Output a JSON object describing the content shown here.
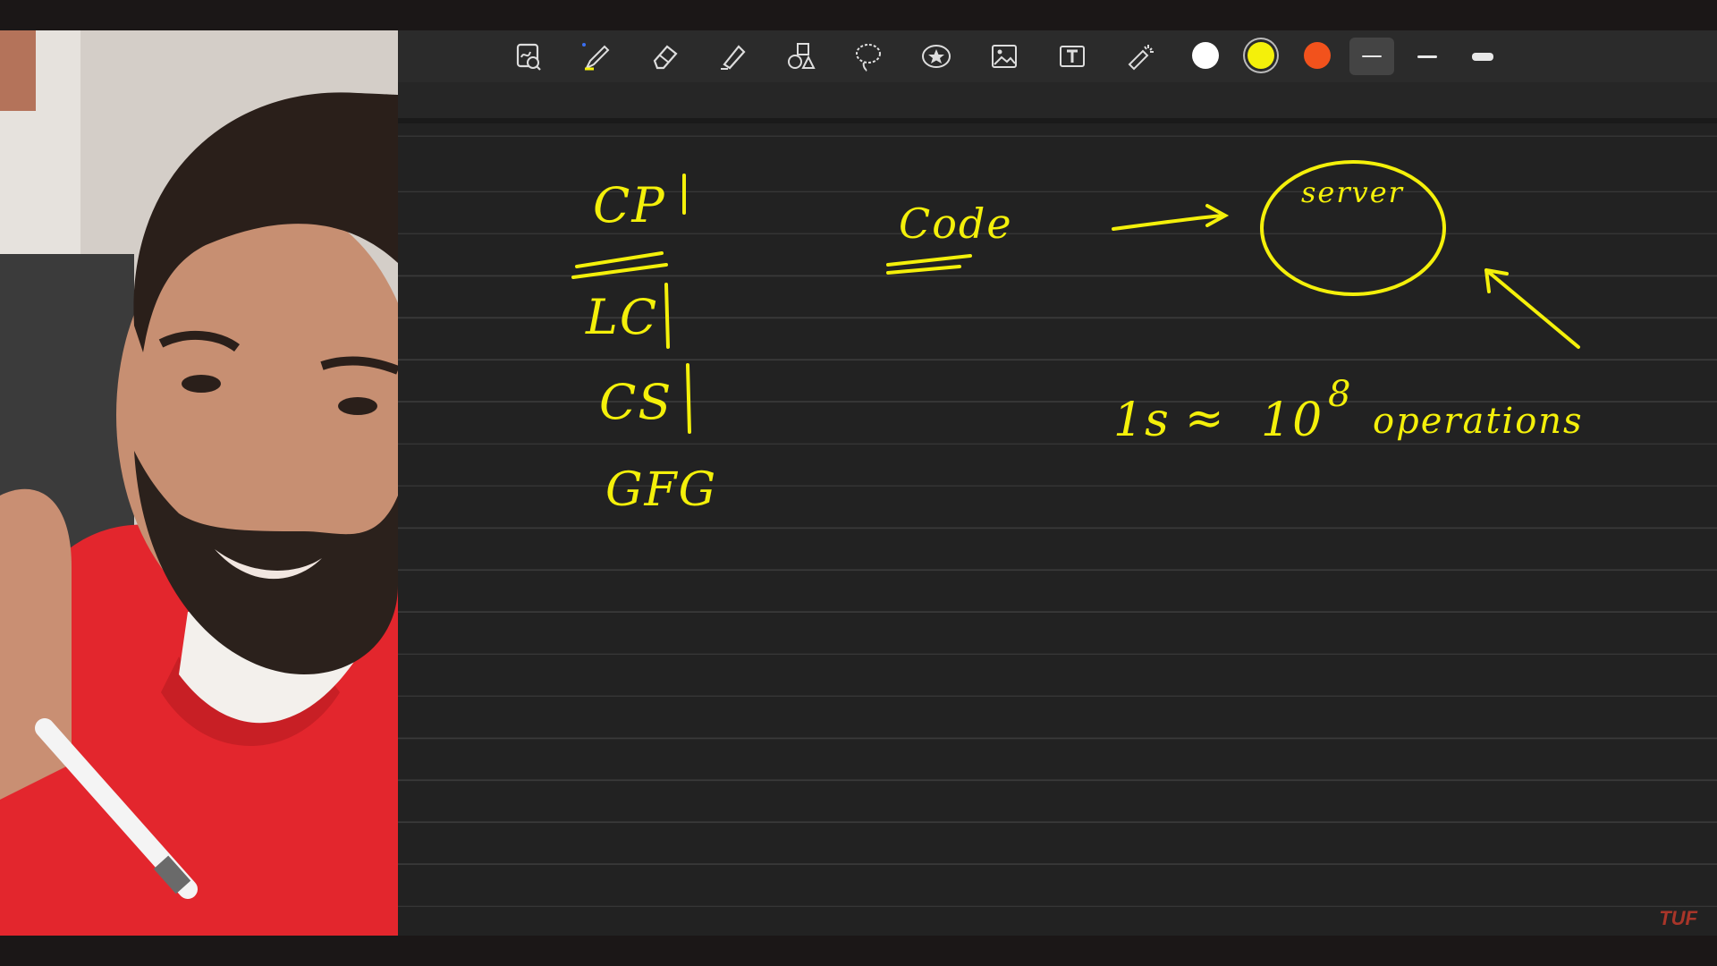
{
  "toolbar": {
    "tools": [
      {
        "name": "add-page-tool",
        "icon": "page-add-icon"
      },
      {
        "name": "pen-tool",
        "icon": "pen-icon"
      },
      {
        "name": "eraser-tool",
        "icon": "eraser-icon"
      },
      {
        "name": "highlighter-tool",
        "icon": "highlighter-icon"
      },
      {
        "name": "shapes-tool",
        "icon": "shapes-icon"
      },
      {
        "name": "lasso-tool",
        "icon": "lasso-icon"
      },
      {
        "name": "sticker-tool",
        "icon": "star-sticker-icon"
      },
      {
        "name": "image-tool",
        "icon": "image-icon"
      },
      {
        "name": "text-tool",
        "icon": "text-box-icon"
      },
      {
        "name": "laser-pointer-tool",
        "icon": "laser-pointer-icon"
      }
    ],
    "colors": [
      "#ffffff",
      "#f4f00a",
      "#f2521c"
    ],
    "selected_color": "#f4f00a",
    "stroke_widths": [
      "thin",
      "medium",
      "thick"
    ],
    "selected_stroke": "thin"
  },
  "canvas": {
    "handwriting": {
      "cp": "CP",
      "lc": "LC",
      "cs": "CS",
      "gfg": "GFG",
      "code": "Code",
      "server": "server",
      "time": "1s",
      "approx": "≈",
      "ten": "10",
      "exponent": "8",
      "operations": "operations"
    },
    "ink_color": "#f4f00a"
  },
  "watermark": "TUF"
}
